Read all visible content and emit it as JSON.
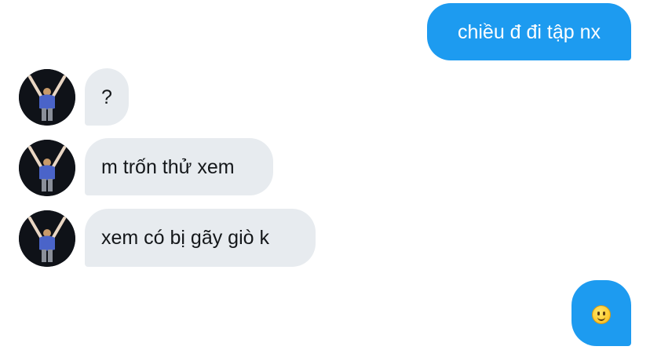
{
  "conversation": {
    "messages": [
      {
        "direction": "sent",
        "text": "chiều đ đi tập nx"
      },
      {
        "direction": "received",
        "text": "?"
      },
      {
        "direction": "received",
        "text": "m trốn thử xem"
      },
      {
        "direction": "received",
        "text": "xem có bị gãy giò k"
      },
      {
        "direction": "sent",
        "emoji": "slightly-smiling-face"
      }
    ]
  },
  "colors": {
    "sent_bubble": "#1d9bf0",
    "received_bubble": "#e7ebef",
    "sent_text": "#ffffff",
    "received_text": "#14171a"
  }
}
